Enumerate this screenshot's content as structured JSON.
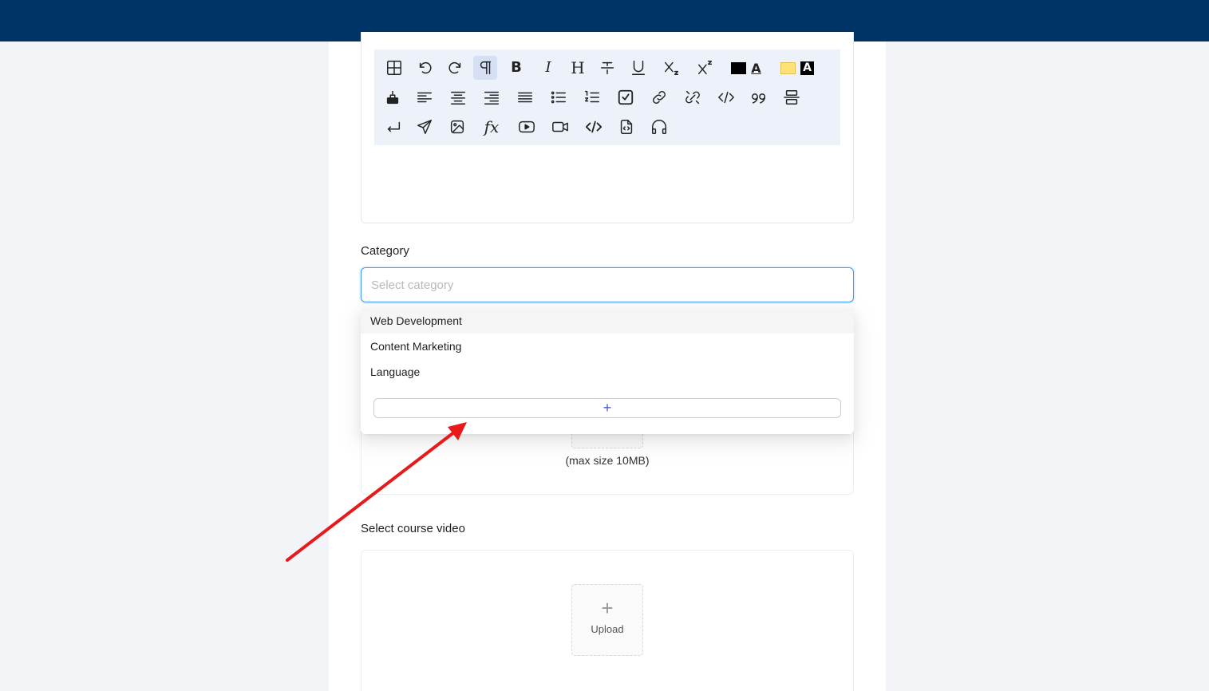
{
  "toolbar": {
    "row1": [
      "table-icon",
      "undo-icon",
      "redo-icon",
      "paragraph-icon",
      "bold-icon",
      "italic-icon",
      "heading-icon",
      "strikethrough-icon",
      "underline-icon",
      "subscript-icon",
      "superscript-icon",
      "font-color-icon",
      "highlight-color-icon"
    ],
    "row2": [
      "clear-format-icon",
      "align-left-icon",
      "align-center-icon",
      "align-right-icon",
      "align-justify-icon",
      "bullet-list-icon",
      "numbered-list-icon",
      "checklist-icon",
      "link-icon",
      "unlink-icon",
      "code-inline-icon",
      "quote-icon",
      "page-break-icon"
    ],
    "row3": [
      "enter-icon",
      "send-icon",
      "image-icon",
      "formula-icon",
      "youtube-icon",
      "video-icon",
      "code-block-icon",
      "file-code-icon",
      "audio-icon"
    ],
    "labels": {
      "bold": "B",
      "italic": "I",
      "heading": "H",
      "formula": "fx",
      "font_color": "A",
      "highlight": "A"
    },
    "colors": {
      "font_color": "#000000",
      "highlight": "#ffe177"
    }
  },
  "category": {
    "label": "Category",
    "placeholder": "Select category",
    "options": [
      "Web Development",
      "Content Marketing",
      "Language"
    ],
    "add_label": "+"
  },
  "thumbnail": {
    "max_size": "(max size 10MB)"
  },
  "video": {
    "label": "Select course video",
    "upload_plus": "+",
    "upload_label": "Upload"
  },
  "theme": {
    "header": "#003366",
    "accent": "#4096ff",
    "arrow": "#e8191b"
  }
}
